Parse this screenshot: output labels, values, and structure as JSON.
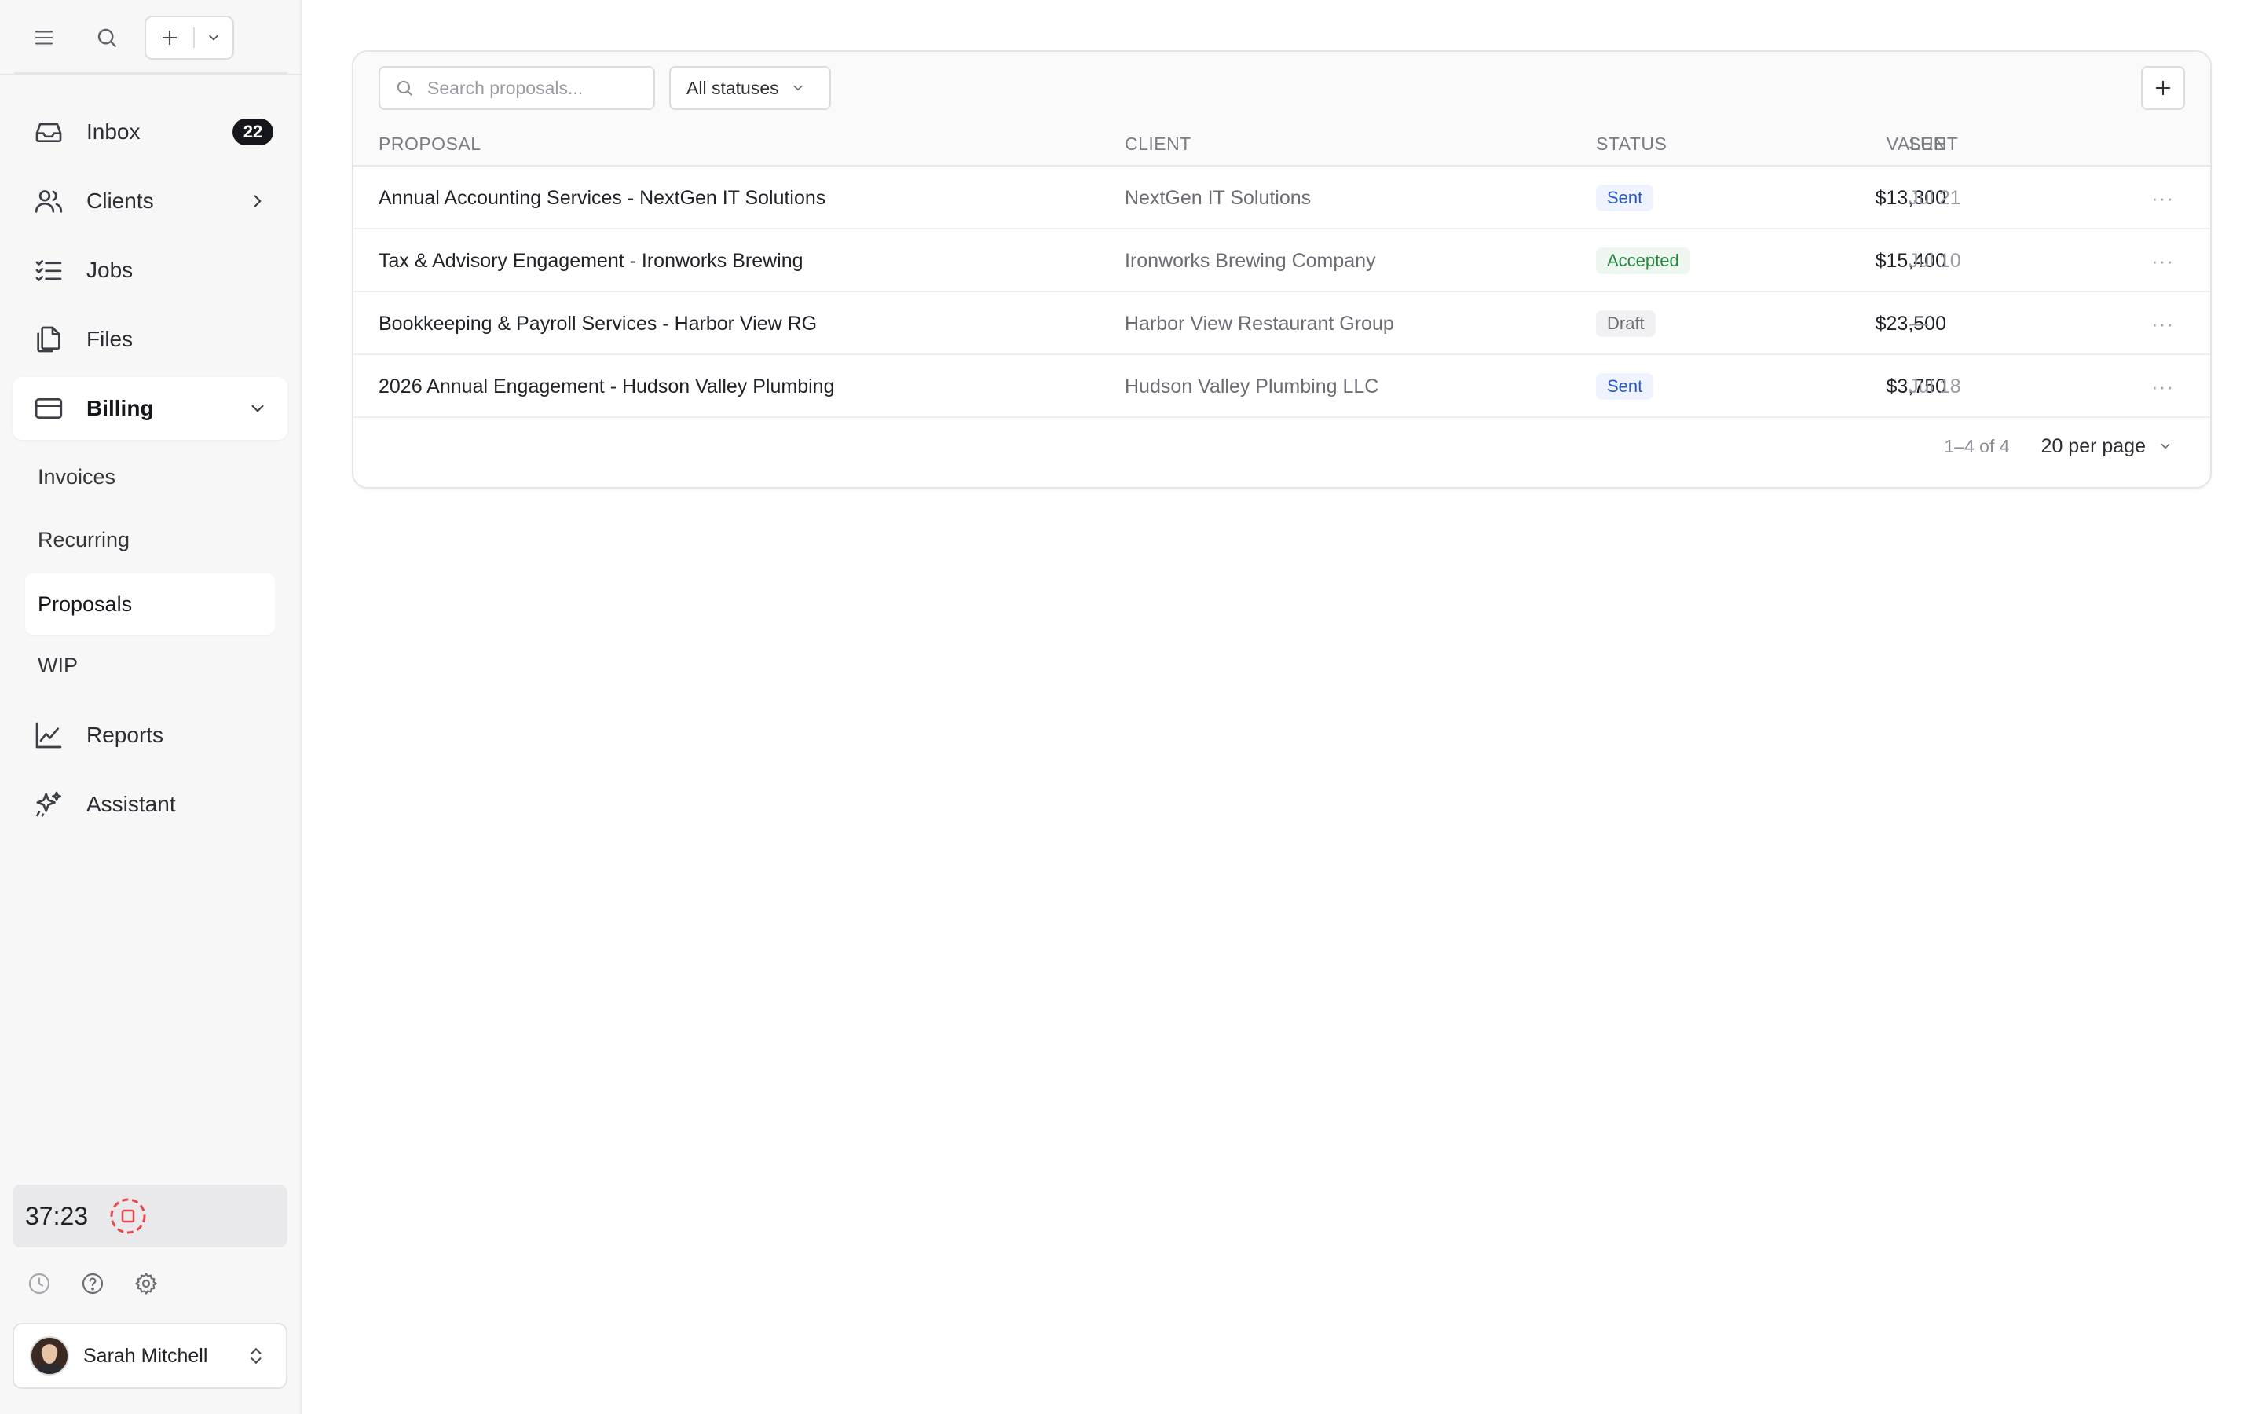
{
  "sidebar": {
    "nav": [
      {
        "key": "inbox",
        "label": "Inbox",
        "badge": "22"
      },
      {
        "key": "clients",
        "label": "Clients"
      },
      {
        "key": "jobs",
        "label": "Jobs"
      },
      {
        "key": "files",
        "label": "Files"
      },
      {
        "key": "billing",
        "label": "Billing"
      },
      {
        "key": "reports",
        "label": "Reports"
      },
      {
        "key": "assistant",
        "label": "Assistant"
      }
    ],
    "billing_sub": [
      {
        "label": "Invoices"
      },
      {
        "label": "Recurring"
      },
      {
        "label": "Proposals",
        "active": true
      },
      {
        "label": "WIP"
      }
    ],
    "timer": {
      "time": "37:23"
    },
    "user": {
      "name": "Sarah Mitchell"
    }
  },
  "toolbar": {
    "search_placeholder": "Search proposals...",
    "status_filter": "All statuses"
  },
  "table": {
    "headers": {
      "proposal": "PROPOSAL",
      "client": "CLIENT",
      "status": "STATUS",
      "value": "VALUE",
      "sent": "SENT"
    },
    "rows": [
      {
        "proposal": "Annual Accounting Services - NextGen IT Solutions",
        "client": "NextGen IT Solutions",
        "status": "Sent",
        "value": "$13,300",
        "sent": "Jul 21"
      },
      {
        "proposal": "Tax & Advisory Engagement - Ironworks Brewing",
        "client": "Ironworks Brewing Company",
        "status": "Accepted",
        "value": "$15,400",
        "sent": "Jul 10"
      },
      {
        "proposal": "Bookkeeping & Payroll Services - Harbor View RG",
        "client": "Harbor View Restaurant Group",
        "status": "Draft",
        "value": "$23,500",
        "sent": "—"
      },
      {
        "proposal": "2026 Annual Engagement - Hudson Valley Plumbing",
        "client": "Hudson Valley Plumbing LLC",
        "status": "Sent",
        "value": "$3,750",
        "sent": "Jul 18"
      }
    ],
    "more_glyph": "···"
  },
  "pagination": {
    "range": "1–4 of 4",
    "per_page": "20 per page"
  },
  "colors": {
    "accent_sent": "#2957c9",
    "accent_accepted": "#25853e",
    "timer_stop": "#e5484d"
  }
}
